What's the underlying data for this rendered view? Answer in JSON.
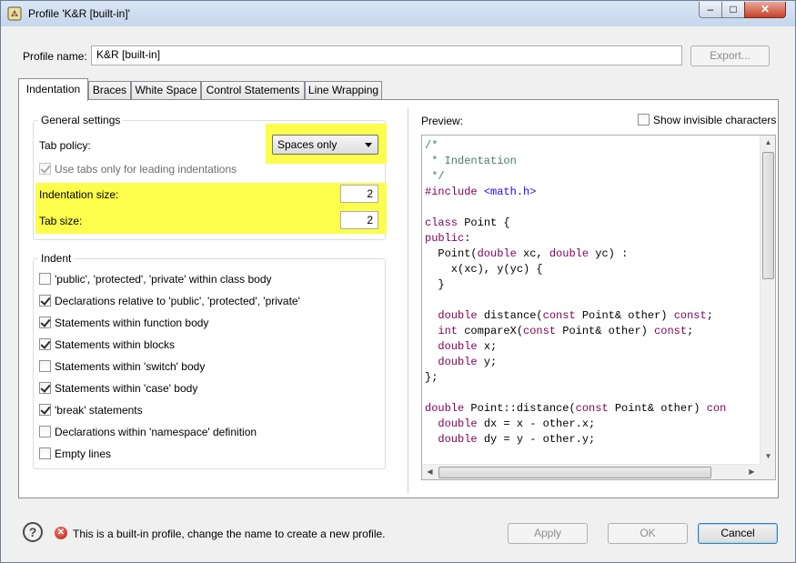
{
  "window": {
    "title": "Profile 'K&R [built-in]'",
    "controls": {
      "minimize": "–",
      "maximize": "□",
      "close": "✕"
    }
  },
  "profile": {
    "label": "Profile name:",
    "value": "K&R [built-in]",
    "export_label": "Export..."
  },
  "tabs": [
    {
      "label": "Indentation",
      "active": true
    },
    {
      "label": "Braces",
      "active": false
    },
    {
      "label": "White Space",
      "active": false
    },
    {
      "label": "Control Statements",
      "active": false
    },
    {
      "label": "Line Wrapping",
      "active": false
    }
  ],
  "general": {
    "title": "General settings",
    "tab_policy_label": "Tab policy:",
    "tab_policy_value": "Spaces only",
    "leading_tabs_label": "Use tabs only for leading indentations",
    "leading_tabs_checked": true,
    "indentation_size_label": "Indentation size:",
    "indentation_size_value": "2",
    "tab_size_label": "Tab size:",
    "tab_size_value": "2",
    "highlight_color": "#fdfd4b"
  },
  "indent": {
    "title": "Indent",
    "items": [
      {
        "label": "'public', 'protected', 'private' within class body",
        "checked": false
      },
      {
        "label": "Declarations relative to 'public', 'protected', 'private'",
        "checked": true
      },
      {
        "label": "Statements within function body",
        "checked": true
      },
      {
        "label": "Statements within blocks",
        "checked": true
      },
      {
        "label": "Statements within 'switch' body",
        "checked": false
      },
      {
        "label": "Statements within 'case' body",
        "checked": true
      },
      {
        "label": "'break' statements",
        "checked": true
      },
      {
        "label": "Declarations within 'namespace' definition",
        "checked": false
      },
      {
        "label": "Empty lines",
        "checked": false
      }
    ]
  },
  "preview": {
    "label": "Preview:",
    "show_invisible_label": "Show invisible characters",
    "show_invisible_checked": false,
    "code_lines": [
      [
        [
          "c",
          "/*"
        ]
      ],
      [
        [
          "c",
          " * Indentation"
        ]
      ],
      [
        [
          "c",
          " */"
        ]
      ],
      [
        [
          "i",
          "#include "
        ],
        [
          "f",
          "<math.h>"
        ]
      ],
      [],
      [
        [
          "k",
          "class"
        ],
        [
          "p",
          " Point {"
        ]
      ],
      [
        [
          "k",
          "public"
        ],
        [
          "p",
          ":"
        ]
      ],
      [
        [
          "p",
          "  Point("
        ],
        [
          "k",
          "double"
        ],
        [
          "p",
          " xc, "
        ],
        [
          "k",
          "double"
        ],
        [
          "p",
          " yc) :"
        ]
      ],
      [
        [
          "p",
          "    x(xc), y(yc) {"
        ]
      ],
      [
        [
          "p",
          "  }"
        ]
      ],
      [],
      [
        [
          "p",
          "  "
        ],
        [
          "k",
          "double"
        ],
        [
          "p",
          " distance("
        ],
        [
          "k",
          "const"
        ],
        [
          "p",
          " Point& other) "
        ],
        [
          "k",
          "const"
        ],
        [
          "p",
          ";"
        ]
      ],
      [
        [
          "p",
          "  "
        ],
        [
          "k",
          "int"
        ],
        [
          "p",
          " compareX("
        ],
        [
          "k",
          "const"
        ],
        [
          "p",
          " Point& other) "
        ],
        [
          "k",
          "const"
        ],
        [
          "p",
          ";"
        ]
      ],
      [
        [
          "p",
          "  "
        ],
        [
          "k",
          "double"
        ],
        [
          "p",
          " x;"
        ]
      ],
      [
        [
          "p",
          "  "
        ],
        [
          "k",
          "double"
        ],
        [
          "p",
          " y;"
        ]
      ],
      [
        [
          "p",
          "};"
        ]
      ],
      [],
      [
        [
          "k",
          "double"
        ],
        [
          "p",
          " Point::distance("
        ],
        [
          "k",
          "const"
        ],
        [
          "p",
          " Point& other) "
        ],
        [
          "k",
          "con"
        ]
      ],
      [
        [
          "p",
          "  "
        ],
        [
          "k",
          "double"
        ],
        [
          "p",
          " dx = x - other.x;"
        ]
      ],
      [
        [
          "p",
          "  "
        ],
        [
          "k",
          "double"
        ],
        [
          "p",
          " dy = y - other.y;"
        ]
      ]
    ]
  },
  "footer": {
    "help_glyph": "?",
    "error_glyph": "✕",
    "message": "This is a built-in profile, change the name to create a new profile.",
    "apply_label": "Apply",
    "ok_label": "OK",
    "cancel_label": "Cancel"
  }
}
